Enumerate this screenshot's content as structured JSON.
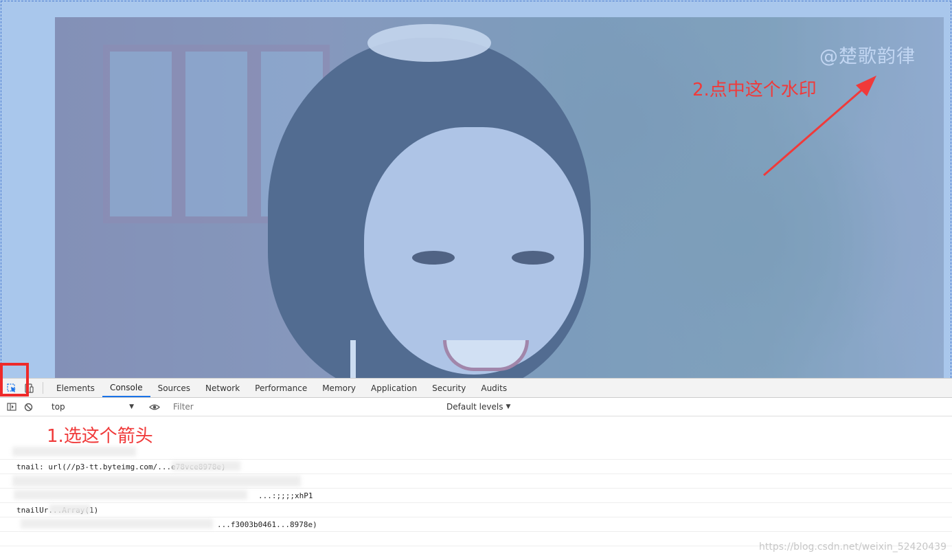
{
  "viewport": {
    "watermark_text": "@楚歌韵律",
    "annotation_step2": "2.点中这个水印"
  },
  "devtools": {
    "tabs": [
      {
        "label": "Elements",
        "active": false
      },
      {
        "label": "Console",
        "active": true
      },
      {
        "label": "Sources",
        "active": false
      },
      {
        "label": "Network",
        "active": false
      },
      {
        "label": "Performance",
        "active": false
      },
      {
        "label": "Memory",
        "active": false
      },
      {
        "label": "Application",
        "active": false
      },
      {
        "label": "Security",
        "active": false
      },
      {
        "label": "Audits",
        "active": false
      }
    ],
    "context_select": "top",
    "filter_placeholder": "Filter",
    "levels_label": "Default levels",
    "annotation_step1": "1.选这个箭头",
    "log_lines": [
      "tnail: url(//p3-tt.byteimg.com/...e78vce8978e)",
      "...:;;;;xhP1",
      "tnailUr...Array(1)",
      "...f3003b0461...8978e)"
    ],
    "accent_color": "#1a73e8",
    "annotation_color": "#f03a3a"
  },
  "footer": {
    "url_watermark": "https://blog.csdn.net/weixin_52420439"
  },
  "icons": [
    "element-picker-icon",
    "device-toggle-icon",
    "sidebar-toggle-icon",
    "clear-console-icon",
    "eye-icon",
    "dropdown-arrow-icon"
  ]
}
